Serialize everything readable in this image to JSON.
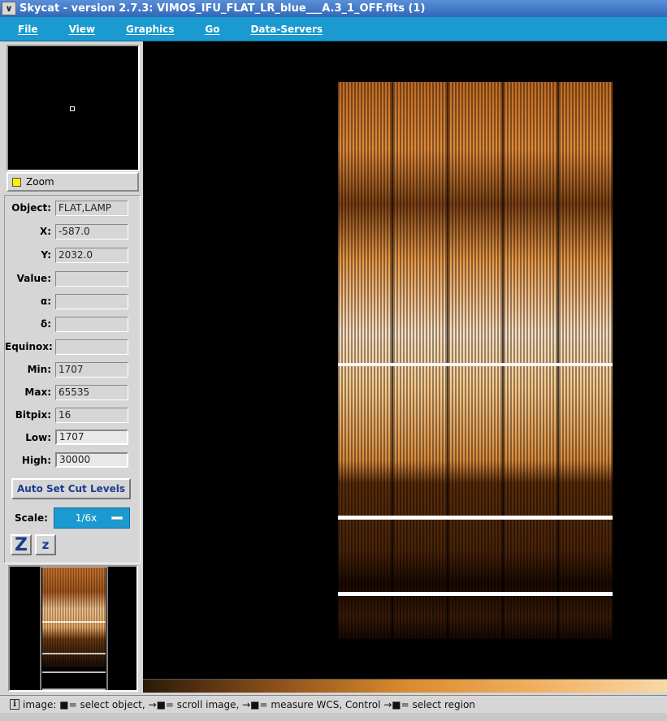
{
  "window": {
    "title": "Skycat - version 2.7.3: VIMOS_IFU_FLAT_LR_blue___A.3_1_OFF.fits (1)",
    "menu_button_glyph": "∨"
  },
  "menubar": {
    "items": [
      "File",
      "View",
      "Graphics",
      "Go",
      "Data-Servers"
    ]
  },
  "zoom": {
    "label": "Zoom",
    "checked": true
  },
  "info": {
    "object_label": "Object:",
    "object_value": "FLAT,LAMP",
    "x_label": "X:",
    "x_value": "-587.0",
    "y_label": "Y:",
    "y_value": "2032.0",
    "value_label": "Value:",
    "value_value": "",
    "alpha_label": "α:",
    "alpha_value": "",
    "delta_label": "δ:",
    "delta_value": "",
    "equinox_label": "Equinox:",
    "equinox_value": "",
    "min_label": "Min:",
    "min_value": "1707",
    "max_label": "Max:",
    "max_value": "65535",
    "bitpix_label": "Bitpix:",
    "bitpix_value": "16",
    "low_label": "Low:",
    "low_value": "1707",
    "high_label": "High:",
    "high_value": "30000"
  },
  "controls": {
    "auto_cut_label": "Auto Set Cut Levels",
    "scale_label": "Scale:",
    "scale_value": "1/6x",
    "zoom_in_glyph": "Z",
    "zoom_out_glyph": "z"
  },
  "statusbar": {
    "icon_glyph": "i",
    "text": "image: ■= select object, →■= scroll image, →■= measure WCS, Control →■= select region"
  },
  "colors": {
    "accent": "#1a9ad0",
    "title_bar": "#3a72c4",
    "image_hot": "#f0a050"
  }
}
